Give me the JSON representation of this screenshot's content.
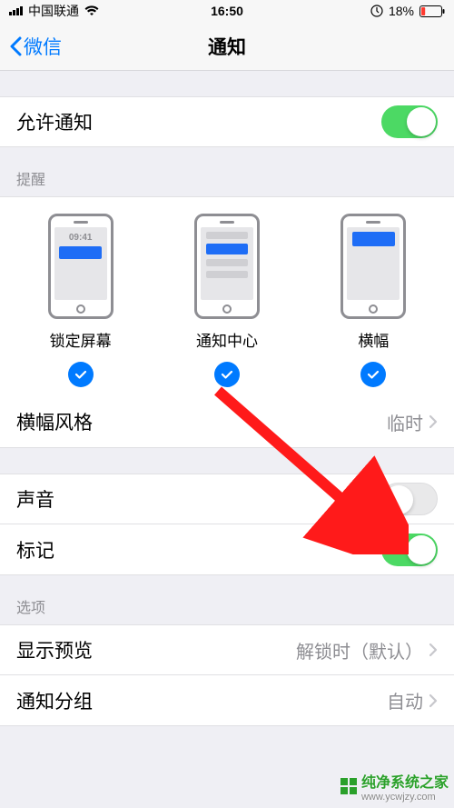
{
  "statusbar": {
    "carrier": "中国联通",
    "time": "16:50",
    "battery_pct": "18%"
  },
  "nav": {
    "back_label": "微信",
    "title": "通知"
  },
  "allow": {
    "label": "允许通知",
    "on": true
  },
  "alerts": {
    "header": "提醒",
    "lock_label": "锁定屏幕",
    "lock_time": "09:41",
    "nc_label": "通知中心",
    "banner_label": "横幅"
  },
  "banner_style": {
    "label": "横幅风格",
    "value": "临时"
  },
  "sound": {
    "label": "声音",
    "on": false
  },
  "badge": {
    "label": "标记",
    "on": true
  },
  "options": {
    "header": "选项",
    "preview_label": "显示预览",
    "preview_value": "解锁时（默认）",
    "group_label": "通知分组",
    "group_value": "自动"
  },
  "watermark": {
    "main": "纯净系统之家",
    "sub": "www.ycwjzy.com"
  }
}
